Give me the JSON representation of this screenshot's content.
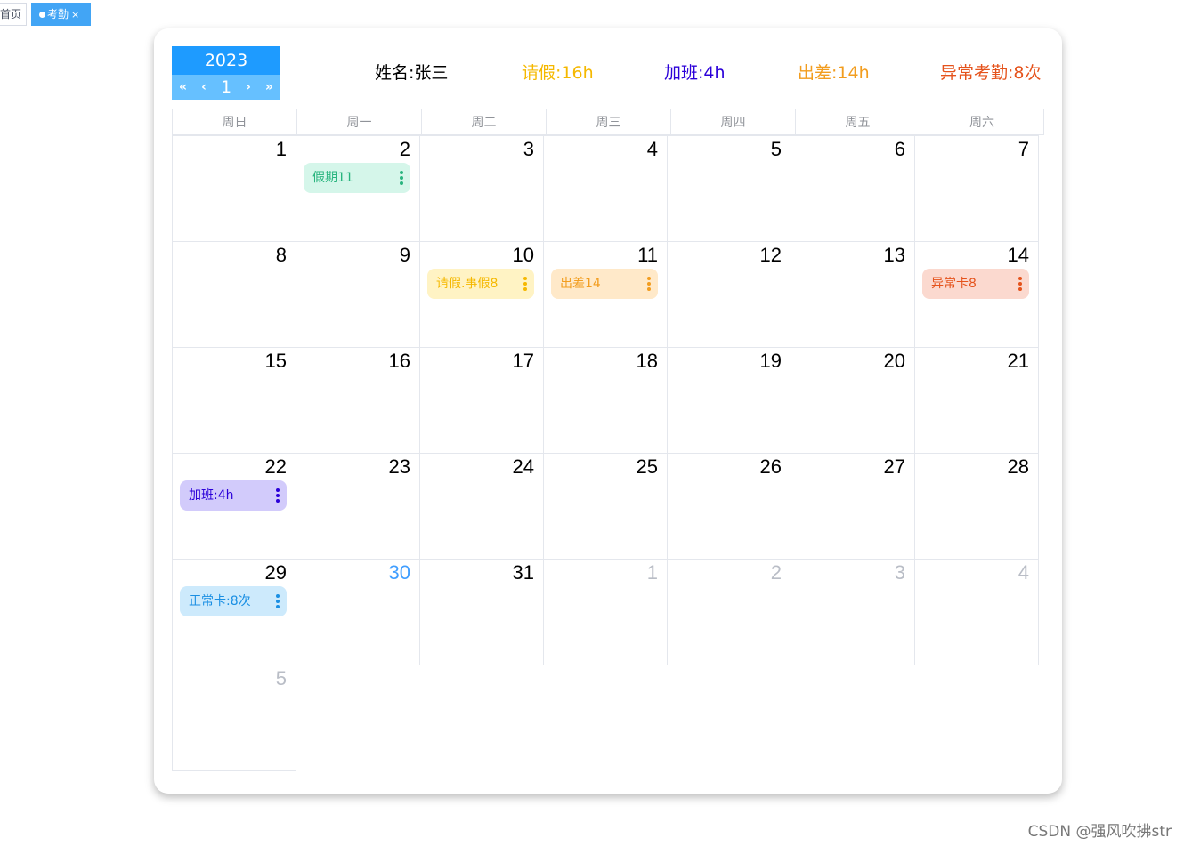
{
  "tabs": {
    "home_label": "首页",
    "active_label": "考勤",
    "close_glyph": "×"
  },
  "calendar": {
    "year": "2023",
    "month": "1",
    "nav": {
      "prev_year": "«",
      "prev_month": "‹",
      "next_month": "›",
      "next_year": "»"
    },
    "summary": {
      "name": "姓名:张三",
      "leave": "请假:16h",
      "overtime": "加班:4h",
      "business_trip": "出差:14h",
      "abnormal": "异常考勤:8次"
    },
    "summary_colors": {
      "name": "#000000",
      "leave": "#f5b800",
      "overtime": "#2b00d9",
      "business_trip": "#f29d1f",
      "abnormal": "#e5531c"
    },
    "weekdays": [
      "周日",
      "周一",
      "周二",
      "周三",
      "周四",
      "周五",
      "周六"
    ],
    "days": [
      {
        "n": "1"
      },
      {
        "n": "2",
        "event": 0
      },
      {
        "n": "3"
      },
      {
        "n": "4"
      },
      {
        "n": "5"
      },
      {
        "n": "6"
      },
      {
        "n": "7"
      },
      {
        "n": "8"
      },
      {
        "n": "9"
      },
      {
        "n": "10",
        "event": 1
      },
      {
        "n": "11",
        "event": 2
      },
      {
        "n": "12"
      },
      {
        "n": "13"
      },
      {
        "n": "14",
        "event": 3
      },
      {
        "n": "15"
      },
      {
        "n": "16"
      },
      {
        "n": "17"
      },
      {
        "n": "18"
      },
      {
        "n": "19"
      },
      {
        "n": "20"
      },
      {
        "n": "21"
      },
      {
        "n": "22",
        "event": 4
      },
      {
        "n": "23"
      },
      {
        "n": "24"
      },
      {
        "n": "25"
      },
      {
        "n": "26"
      },
      {
        "n": "27"
      },
      {
        "n": "28"
      },
      {
        "n": "29",
        "event": 5
      },
      {
        "n": "30",
        "today": true
      },
      {
        "n": "31"
      },
      {
        "n": "1",
        "other": true
      },
      {
        "n": "2",
        "other": true
      },
      {
        "n": "3",
        "other": true
      },
      {
        "n": "4",
        "other": true
      },
      {
        "n": "5",
        "other": true
      }
    ],
    "events": [
      {
        "label": "假期11",
        "bg": "#d5f6ea",
        "fg": "#28b47e"
      },
      {
        "label": "请假.事假8",
        "bg": "#fff3c4",
        "fg": "#f5b800"
      },
      {
        "label": "出差14",
        "bg": "#ffe9c9",
        "fg": "#f29d1f"
      },
      {
        "label": "异常卡8",
        "bg": "#fbd9cf",
        "fg": "#e5531c"
      },
      {
        "label": "加班:4h",
        "bg": "#d2cbfb",
        "fg": "#2b00d9"
      },
      {
        "label": "正常卡:8次",
        "bg": "#cdeafc",
        "fg": "#1a8fe3"
      }
    ]
  },
  "watermark": "CSDN @强风吹拂str"
}
